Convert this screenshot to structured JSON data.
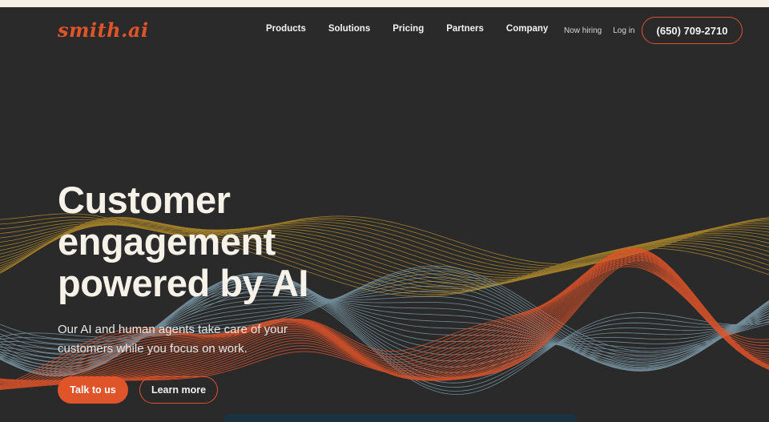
{
  "brand": {
    "logo_text": "smith.ai",
    "accent": "#e0542a"
  },
  "nav": {
    "items": [
      "Products",
      "Solutions",
      "Pricing",
      "Partners",
      "Company"
    ],
    "now_hiring": "Now hiring",
    "login": "Log in",
    "phone": "(650) 709-2710"
  },
  "hero": {
    "headline_lines": [
      "Customer",
      "engagement",
      "powered by AI"
    ],
    "subtext": "Our AI and human agents take care of your customers while you focus on work.",
    "primary_cta": "Talk to us",
    "secondary_cta": "Learn more"
  },
  "colors": {
    "background": "#2a2a2a",
    "wave_orange": "#e0542a",
    "wave_blue": "#8fb3c4",
    "wave_gold": "#c89a2a"
  }
}
